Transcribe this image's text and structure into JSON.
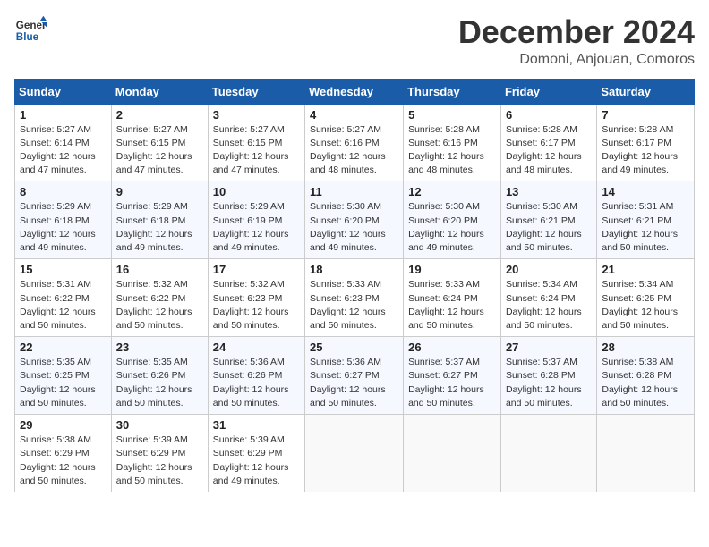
{
  "logo": {
    "general": "General",
    "blue": "Blue"
  },
  "title": "December 2024",
  "location": "Domoni, Anjouan, Comoros",
  "weekdays": [
    "Sunday",
    "Monday",
    "Tuesday",
    "Wednesday",
    "Thursday",
    "Friday",
    "Saturday"
  ],
  "weeks": [
    [
      {
        "day": "1",
        "info": "Sunrise: 5:27 AM\nSunset: 6:14 PM\nDaylight: 12 hours\nand 47 minutes."
      },
      {
        "day": "2",
        "info": "Sunrise: 5:27 AM\nSunset: 6:15 PM\nDaylight: 12 hours\nand 47 minutes."
      },
      {
        "day": "3",
        "info": "Sunrise: 5:27 AM\nSunset: 6:15 PM\nDaylight: 12 hours\nand 47 minutes."
      },
      {
        "day": "4",
        "info": "Sunrise: 5:27 AM\nSunset: 6:16 PM\nDaylight: 12 hours\nand 48 minutes."
      },
      {
        "day": "5",
        "info": "Sunrise: 5:28 AM\nSunset: 6:16 PM\nDaylight: 12 hours\nand 48 minutes."
      },
      {
        "day": "6",
        "info": "Sunrise: 5:28 AM\nSunset: 6:17 PM\nDaylight: 12 hours\nand 48 minutes."
      },
      {
        "day": "7",
        "info": "Sunrise: 5:28 AM\nSunset: 6:17 PM\nDaylight: 12 hours\nand 49 minutes."
      }
    ],
    [
      {
        "day": "8",
        "info": "Sunrise: 5:29 AM\nSunset: 6:18 PM\nDaylight: 12 hours\nand 49 minutes."
      },
      {
        "day": "9",
        "info": "Sunrise: 5:29 AM\nSunset: 6:18 PM\nDaylight: 12 hours\nand 49 minutes."
      },
      {
        "day": "10",
        "info": "Sunrise: 5:29 AM\nSunset: 6:19 PM\nDaylight: 12 hours\nand 49 minutes."
      },
      {
        "day": "11",
        "info": "Sunrise: 5:30 AM\nSunset: 6:20 PM\nDaylight: 12 hours\nand 49 minutes."
      },
      {
        "day": "12",
        "info": "Sunrise: 5:30 AM\nSunset: 6:20 PM\nDaylight: 12 hours\nand 49 minutes."
      },
      {
        "day": "13",
        "info": "Sunrise: 5:30 AM\nSunset: 6:21 PM\nDaylight: 12 hours\nand 50 minutes."
      },
      {
        "day": "14",
        "info": "Sunrise: 5:31 AM\nSunset: 6:21 PM\nDaylight: 12 hours\nand 50 minutes."
      }
    ],
    [
      {
        "day": "15",
        "info": "Sunrise: 5:31 AM\nSunset: 6:22 PM\nDaylight: 12 hours\nand 50 minutes."
      },
      {
        "day": "16",
        "info": "Sunrise: 5:32 AM\nSunset: 6:22 PM\nDaylight: 12 hours\nand 50 minutes."
      },
      {
        "day": "17",
        "info": "Sunrise: 5:32 AM\nSunset: 6:23 PM\nDaylight: 12 hours\nand 50 minutes."
      },
      {
        "day": "18",
        "info": "Sunrise: 5:33 AM\nSunset: 6:23 PM\nDaylight: 12 hours\nand 50 minutes."
      },
      {
        "day": "19",
        "info": "Sunrise: 5:33 AM\nSunset: 6:24 PM\nDaylight: 12 hours\nand 50 minutes."
      },
      {
        "day": "20",
        "info": "Sunrise: 5:34 AM\nSunset: 6:24 PM\nDaylight: 12 hours\nand 50 minutes."
      },
      {
        "day": "21",
        "info": "Sunrise: 5:34 AM\nSunset: 6:25 PM\nDaylight: 12 hours\nand 50 minutes."
      }
    ],
    [
      {
        "day": "22",
        "info": "Sunrise: 5:35 AM\nSunset: 6:25 PM\nDaylight: 12 hours\nand 50 minutes."
      },
      {
        "day": "23",
        "info": "Sunrise: 5:35 AM\nSunset: 6:26 PM\nDaylight: 12 hours\nand 50 minutes."
      },
      {
        "day": "24",
        "info": "Sunrise: 5:36 AM\nSunset: 6:26 PM\nDaylight: 12 hours\nand 50 minutes."
      },
      {
        "day": "25",
        "info": "Sunrise: 5:36 AM\nSunset: 6:27 PM\nDaylight: 12 hours\nand 50 minutes."
      },
      {
        "day": "26",
        "info": "Sunrise: 5:37 AM\nSunset: 6:27 PM\nDaylight: 12 hours\nand 50 minutes."
      },
      {
        "day": "27",
        "info": "Sunrise: 5:37 AM\nSunset: 6:28 PM\nDaylight: 12 hours\nand 50 minutes."
      },
      {
        "day": "28",
        "info": "Sunrise: 5:38 AM\nSunset: 6:28 PM\nDaylight: 12 hours\nand 50 minutes."
      }
    ],
    [
      {
        "day": "29",
        "info": "Sunrise: 5:38 AM\nSunset: 6:29 PM\nDaylight: 12 hours\nand 50 minutes."
      },
      {
        "day": "30",
        "info": "Sunrise: 5:39 AM\nSunset: 6:29 PM\nDaylight: 12 hours\nand 50 minutes."
      },
      {
        "day": "31",
        "info": "Sunrise: 5:39 AM\nSunset: 6:29 PM\nDaylight: 12 hours\nand 49 minutes."
      },
      {
        "day": "",
        "info": ""
      },
      {
        "day": "",
        "info": ""
      },
      {
        "day": "",
        "info": ""
      },
      {
        "day": "",
        "info": ""
      }
    ]
  ]
}
